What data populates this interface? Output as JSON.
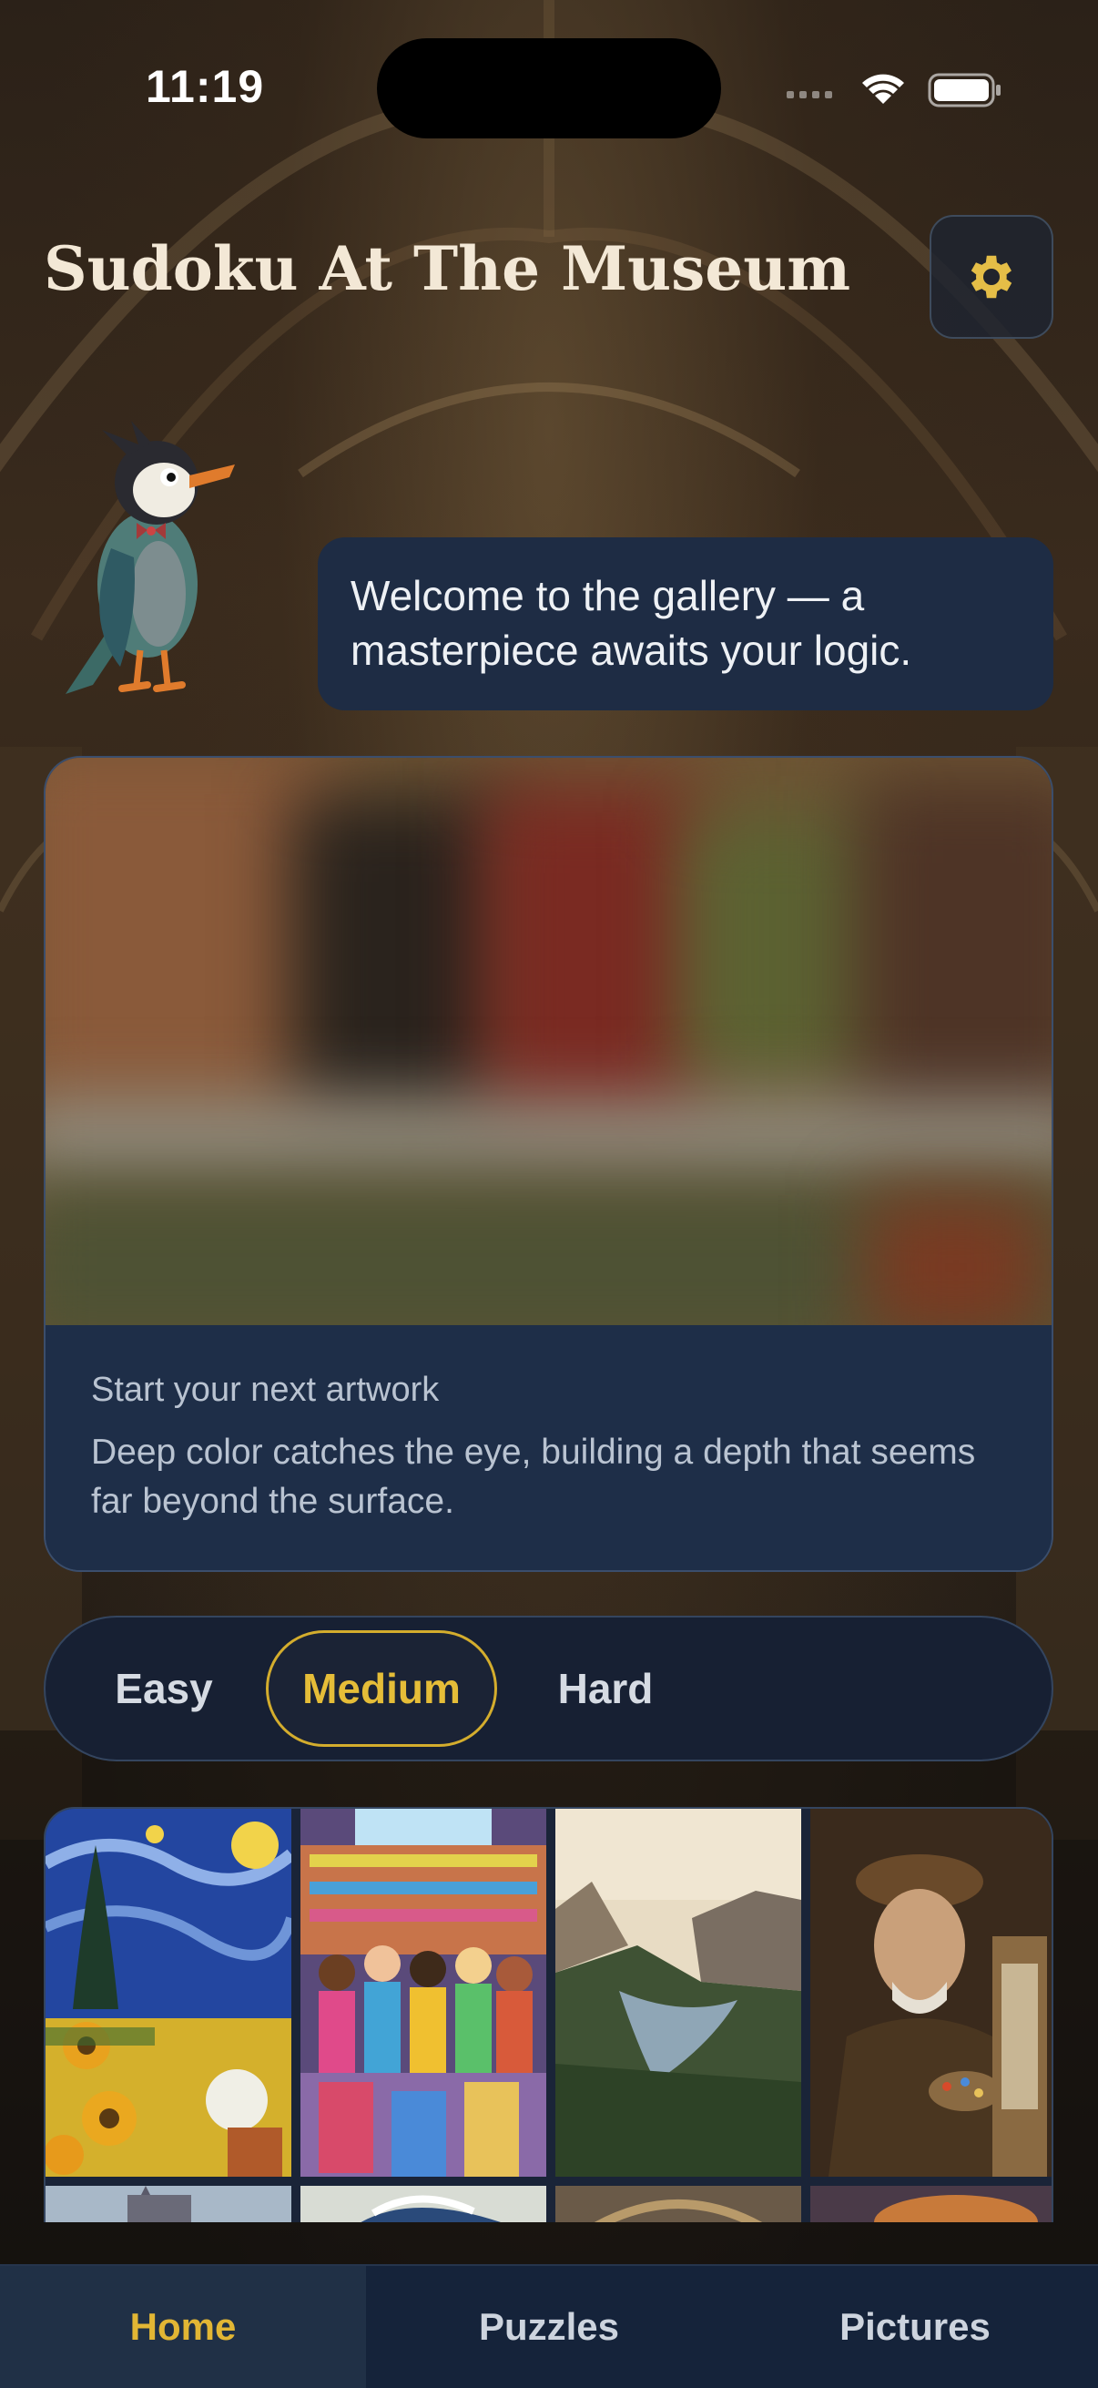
{
  "status": {
    "time": "11:19"
  },
  "header": {
    "title": "Sudoku At The Museum",
    "settings_icon": "gear-icon"
  },
  "mascot": {
    "icon": "bird-mascot-icon"
  },
  "bubble": {
    "text": "Welcome to the gallery — a masterpiece awaits your logic."
  },
  "artwork": {
    "heading": "Start your next artwork",
    "description": "Deep color catches the eye, building a depth that seems far beyond the surface."
  },
  "difficulty": {
    "options": [
      "Easy",
      "Medium",
      "Hard"
    ],
    "selected": "Medium"
  },
  "gallery": {
    "thumbnails": [
      "starry-sunflowers",
      "comic-shop-crowd",
      "river-valley",
      "painter-portrait",
      "cathedral",
      "wave",
      "gallery-hall",
      "sunset"
    ]
  },
  "tabs": {
    "home": "Home",
    "puzzles": "Puzzles",
    "pictures": "Pictures",
    "active": "Home"
  },
  "colors": {
    "accent": "#e2b634",
    "card": "#1e2c44",
    "tabbar": "#15233a"
  }
}
